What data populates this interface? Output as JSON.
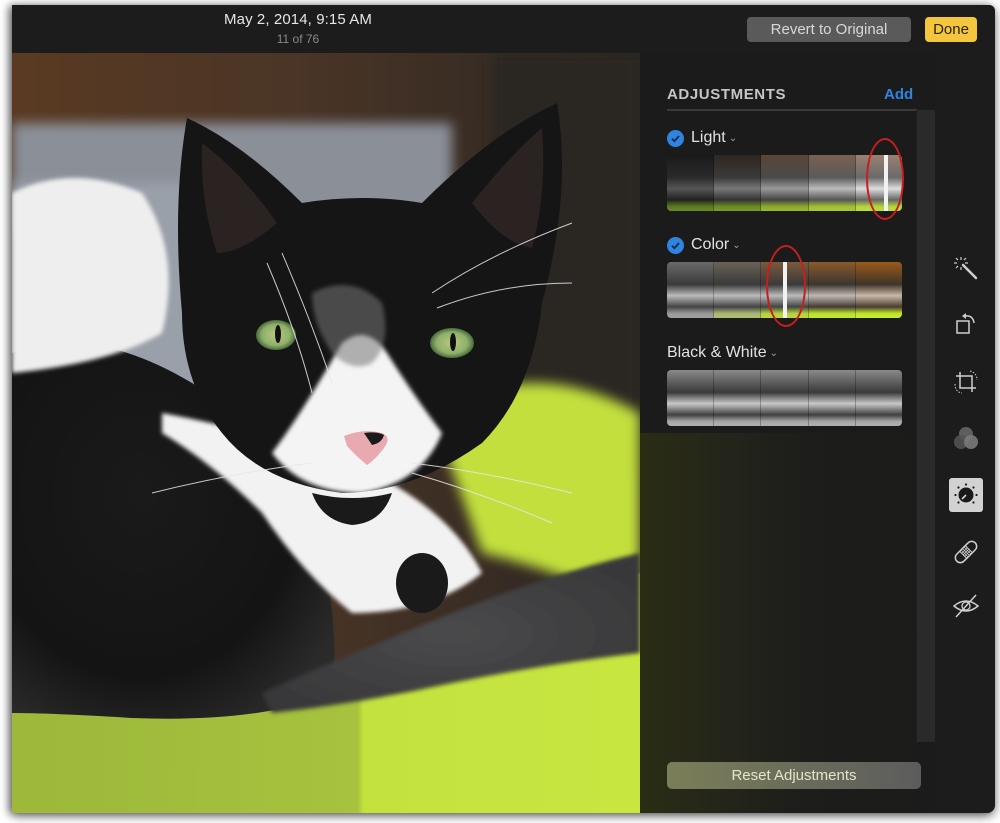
{
  "header": {
    "title": "May 2, 2014, 9:15 AM",
    "subtitle": "11 of 76",
    "revert_label": "Revert to Original",
    "done_label": "Done"
  },
  "photo": {
    "description": "Black and white tuxedo cat with green eyes lying on a lime green cushion"
  },
  "adjustments": {
    "title": "ADJUSTMENTS",
    "add_label": "Add",
    "sections": [
      {
        "label": "Light",
        "enabled": true,
        "has_checkmark": true,
        "slider_value": 0.93,
        "style": "light"
      },
      {
        "label": "Color",
        "enabled": true,
        "has_checkmark": true,
        "slider_value": 0.5,
        "style": "color"
      },
      {
        "label": "Black & White",
        "enabled": false,
        "has_checkmark": false,
        "slider_value": null,
        "style": "bw"
      }
    ],
    "reset_label": "Reset Adjustments"
  },
  "tools": [
    {
      "name": "enhance",
      "icon": "magic-wand-icon",
      "selected": false
    },
    {
      "name": "rotate",
      "icon": "rotate-icon",
      "selected": false
    },
    {
      "name": "crop",
      "icon": "crop-icon",
      "selected": false
    },
    {
      "name": "filters",
      "icon": "filters-icon",
      "selected": false
    },
    {
      "name": "adjust",
      "icon": "adjust-dial-icon",
      "selected": true
    },
    {
      "name": "retouch",
      "icon": "bandage-icon",
      "selected": false
    },
    {
      "name": "red-eye",
      "icon": "red-eye-icon",
      "selected": false
    }
  ],
  "colors": {
    "accent_blue": "#2f84e0",
    "done_yellow": "#f4c63d",
    "annotation_red": "#c81e1e",
    "window_bg": "#1b1b1b"
  }
}
